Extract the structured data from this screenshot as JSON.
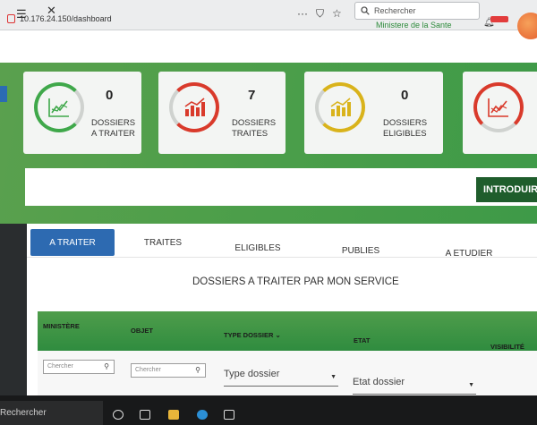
{
  "browser": {
    "url": "10.176.24.150/dashboard",
    "toolbar_icons": [
      "···",
      "⛉",
      "☆"
    ],
    "search_placeholder": "Rechercher"
  },
  "header": {
    "ministry": "Ministere de la Sante"
  },
  "stats": [
    {
      "count": "0",
      "label_line1": "DOSSIERS",
      "label_line2": "A TRAITER",
      "icon": "line-chart-icon",
      "color": "#3fa84a"
    },
    {
      "count": "7",
      "label_line1": "DOSSIERS",
      "label_line2": "TRAITES",
      "icon": "bar-chart-icon",
      "color": "#d93a2b"
    },
    {
      "count": "0",
      "label_line1": "DOSSIERS",
      "label_line2": "ELIGIBLES",
      "icon": "bar-chart-icon",
      "color": "#d9b31b"
    },
    {
      "count": "",
      "label_line1": "",
      "label_line2": "",
      "icon": "line-chart-icon",
      "color": "#d93a2b"
    }
  ],
  "introduce_button": "INTRODUIRE",
  "tabs": [
    "A TRAITER",
    "TRAITES",
    "ELIGIBLES",
    "PUBLIES",
    "A ETUDIER"
  ],
  "active_tab": "A TRAITER",
  "section_title": "DOSSIERS A TRAITER PAR MON SERVICE",
  "table": {
    "columns": [
      "MINISTÈRE",
      "OBJET",
      "TYPE DOSSIER",
      "ETAT",
      "VISIBILITÉ"
    ],
    "filters": {
      "ministere_placeholder": "Chercher",
      "objet_placeholder": "Chercher",
      "type_dossier": "Type dossier",
      "etat_dossier": "Etat dossier"
    }
  },
  "taskbar": {
    "search_text": "Rechercher"
  },
  "colors": {
    "brand_green": "#4e9f4a",
    "active_tab_blue": "#2d6ab1",
    "introduce_dark_green": "#1f5d2c"
  }
}
